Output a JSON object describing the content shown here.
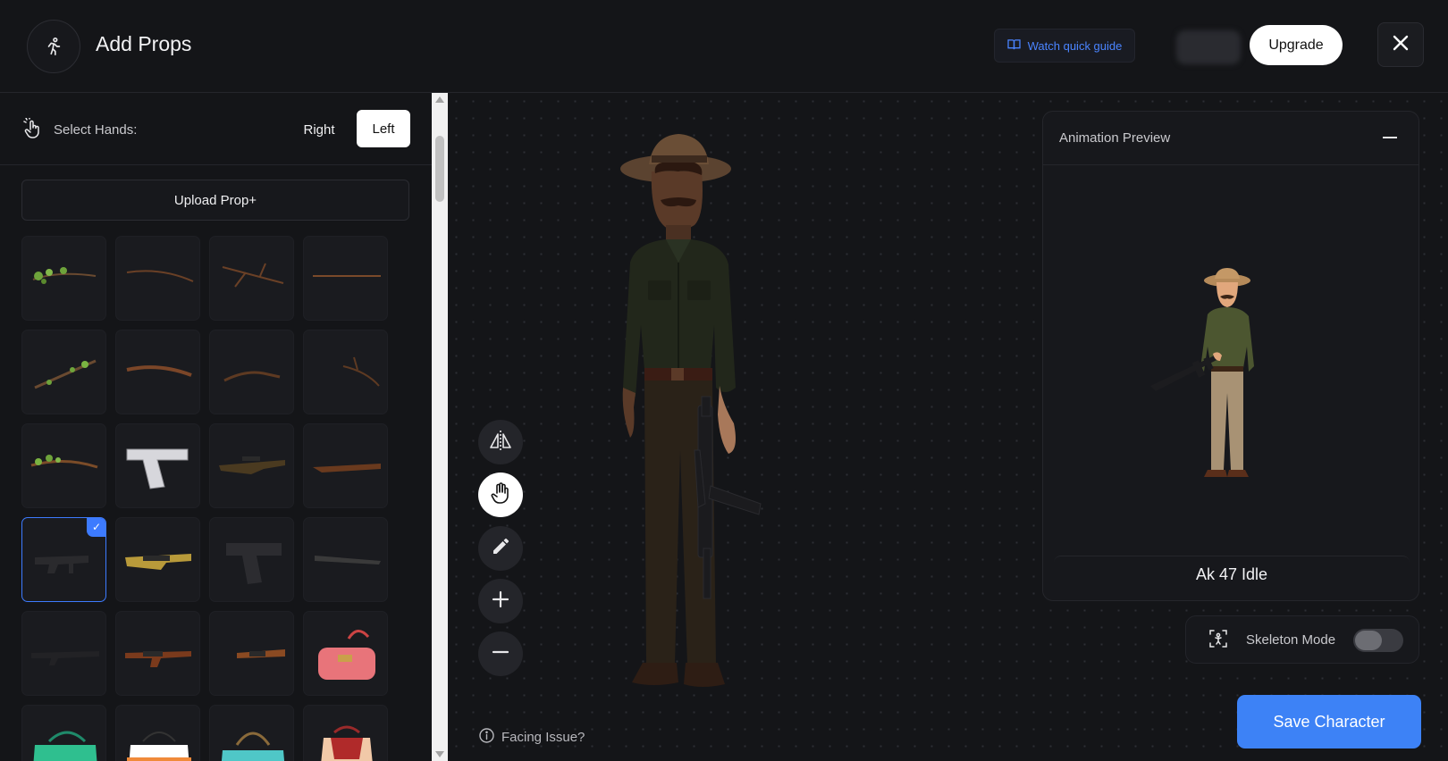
{
  "header": {
    "title": "Add Props",
    "guide_label": "Watch quick guide",
    "upgrade_label": "Upgrade"
  },
  "hands": {
    "label": "Select Hands:",
    "options": [
      "Right",
      "Left"
    ],
    "selected": "Left"
  },
  "upload_label": "Upload Prop+",
  "props": [
    {
      "name": "vine-branch",
      "selected": false
    },
    {
      "name": "thin-branch",
      "selected": false
    },
    {
      "name": "forked-branch",
      "selected": false
    },
    {
      "name": "long-stick",
      "selected": false
    },
    {
      "name": "leafy-branch",
      "selected": false
    },
    {
      "name": "curved-branch",
      "selected": false
    },
    {
      "name": "short-branch",
      "selected": false
    },
    {
      "name": "twig",
      "selected": false
    },
    {
      "name": "mossy-branch",
      "selected": false
    },
    {
      "name": "silver-pistol",
      "selected": false
    },
    {
      "name": "sniper-rifle",
      "selected": false
    },
    {
      "name": "hunting-rifle",
      "selected": false
    },
    {
      "name": "submachine-gun",
      "selected": true
    },
    {
      "name": "gold-rifle",
      "selected": false
    },
    {
      "name": "black-pistol",
      "selected": false
    },
    {
      "name": "shotgun",
      "selected": false
    },
    {
      "name": "assault-rifle",
      "selected": false
    },
    {
      "name": "ak-47",
      "selected": false
    },
    {
      "name": "wood-rifle",
      "selected": false
    },
    {
      "name": "pink-handbag",
      "selected": false
    },
    {
      "name": "green-handbag",
      "selected": false
    },
    {
      "name": "striped-tote",
      "selected": false
    },
    {
      "name": "teal-tote",
      "selected": false
    },
    {
      "name": "red-backpack",
      "selected": false
    }
  ],
  "canvas": {
    "facing_issue": "Facing Issue?"
  },
  "preview": {
    "title": "Animation Preview",
    "animation_name": "Ak 47 Idle"
  },
  "skeleton": {
    "label": "Skeleton Mode",
    "enabled": false
  },
  "save_label": "Save Character",
  "colors": {
    "accent": "#3d82f6",
    "background": "#141518"
  }
}
